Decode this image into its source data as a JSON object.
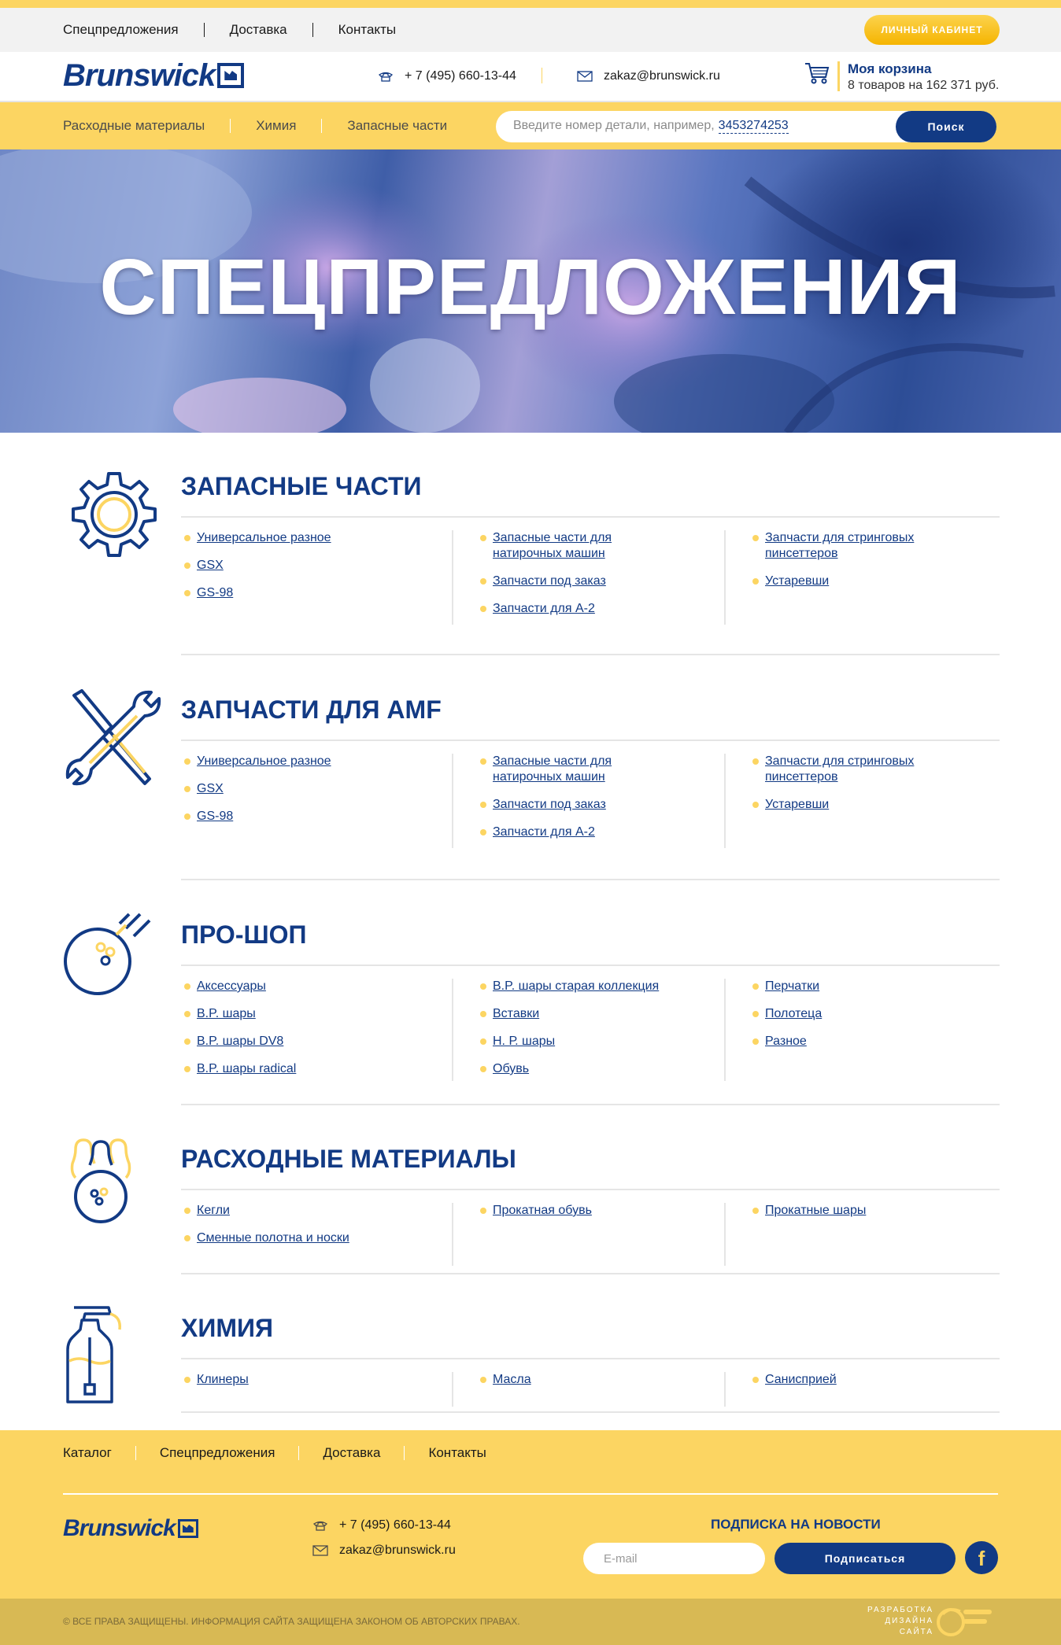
{
  "topbar": {
    "nav": [
      "Спецпредложения",
      "Доставка",
      "Контакты"
    ],
    "cabinet_label": "Личный кабинет"
  },
  "header": {
    "logo": "Brunswick",
    "phone": "+ 7 (495) 660-13-44",
    "email": "zakaz@brunswick.ru",
    "cart_title": "Моя корзина",
    "cart_info": "8 товаров на 162 371 руб."
  },
  "subnav": {
    "items": [
      "Расходные материалы",
      "Химия",
      "Запасные части"
    ],
    "search_placeholder": "Введите номер детали, например,",
    "search_example": "3453274253",
    "search_button": "Поиск"
  },
  "hero": {
    "title": "СПЕЦПРЕДЛОЖЕНИЯ"
  },
  "categories": [
    {
      "title": "Запасные части",
      "icon": "gear-icon",
      "columns": [
        [
          "Универсальное разное",
          "GSX",
          "GS-98"
        ],
        [
          "Запасные части для натирочных машин",
          "Запчасти под заказ",
          "Запчасти для А-2"
        ],
        [
          "Запчасти для стринговых пинсеттеров",
          "Устаревши"
        ]
      ]
    },
    {
      "title": "Запчасти для AMF",
      "icon": "wrench-screwdriver-icon",
      "columns": [
        [
          "Универсальное разное",
          "GSX",
          "GS-98"
        ],
        [
          "Запасные части для натирочных машин",
          "Запчасти под заказ",
          "Запчасти для А-2"
        ],
        [
          "Запчасти для стринговых пинсеттеров",
          "Устаревши"
        ]
      ]
    },
    {
      "title": "Про-шоп",
      "icon": "bowling-ball-icon",
      "columns": [
        [
          "Аксессуары",
          "B.P. шары",
          "B.P. шары DV8",
          "B.P. шары radical"
        ],
        [
          "B.P. шары старая коллекция",
          "Вставки",
          "Н. Р. шары",
          "Обувь"
        ],
        [
          "Перчатки",
          "Полотеца",
          "Разное"
        ]
      ]
    },
    {
      "title": "Расходные материалы",
      "icon": "pins-ball-icon",
      "columns": [
        [
          "Кегли",
          "Сменные полотна и носки"
        ],
        [
          "Прокатная обувь"
        ],
        [
          "Прокатные шары"
        ]
      ]
    },
    {
      "title": "Химия",
      "icon": "spray-bottle-icon",
      "columns": [
        [
          "Клинеры"
        ],
        [
          "Масла"
        ],
        [
          "Санисприей"
        ]
      ]
    }
  ],
  "footer": {
    "nav": [
      "Каталог",
      "Спецпредложения",
      "Доставка",
      "Контакты"
    ],
    "logo": "Brunswick",
    "phone": "+ 7 (495) 660-13-44",
    "email": "zakaz@brunswick.ru",
    "subscribe_title": "Подписка на новости",
    "email_placeholder": "E-mail",
    "subscribe_button": "Подписаться",
    "facebook": "f",
    "copyright": "© Все права защищены. Информация сайта защищена законом об авторских правах.",
    "developer": [
      "Разработка",
      "дизайна",
      "сайта"
    ]
  },
  "colors": {
    "brand_blue": "#123a84",
    "accent_yellow": "#fcd562"
  }
}
